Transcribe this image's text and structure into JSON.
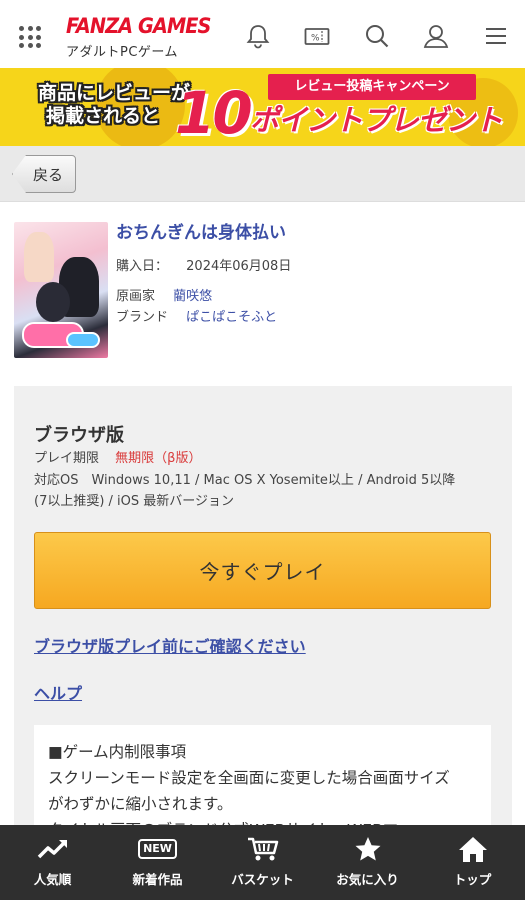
{
  "header": {
    "logo_main": "FANZA GAMES",
    "logo_sub": "アダルトPCゲーム"
  },
  "banner": {
    "line1": "商品にレビューが",
    "line2": "掲載されると",
    "ribbon": "レビュー投稿キャンペーン",
    "ten": "10",
    "point": "ポイントプレゼント"
  },
  "back_label": "戻る",
  "product": {
    "title": "おちんぎんは身体払い",
    "purchase_key": "購入日：",
    "purchase_value": "2024年06月08日",
    "artist_key": "原画家",
    "artist_value": "藺咲悠",
    "brand_key": "ブランド",
    "brand_value": "ぱこぱこそふと"
  },
  "browser": {
    "heading": "ブラウザ版",
    "period_key": "プレイ期限",
    "period_value": "無期限（β版）",
    "os_line1": "対応OS　Windows 10,11 / Mac OS X Yosemite以上 / Android 5以降",
    "os_line2": "(7以上推奨) / iOS 最新バージョン",
    "play_label": "今すぐプレイ",
    "confirm_link": "ブラウザ版プレイ前にご確認ください",
    "help_link": "ヘルプ"
  },
  "notice": {
    "l1": "■ゲーム内制限事項",
    "l2": "スクリーンモード設定を全画面に変更した場合画面サイズ",
    "l3": "がわずかに縮小されます。",
    "l4": "タイトル画面のブランド公式WEBサイト、WEBマニュ"
  },
  "nav": {
    "popular": "人気順",
    "new_badge": "NEW",
    "new_items": "新着作品",
    "basket": "バスケット",
    "favorites": "お気に入り",
    "top": "トップ"
  },
  "icons": {
    "grid": "grid-menu-icon",
    "bell": "bell-icon",
    "coupon": "coupon-icon",
    "search": "search-icon",
    "user": "user-icon",
    "menu": "hamburger-menu-icon"
  },
  "colors": {
    "brand_red": "#e4122b",
    "link_blue": "#3c4fa6",
    "play_orange": "#f6a821",
    "banner_yellow": "#f6d51a"
  }
}
